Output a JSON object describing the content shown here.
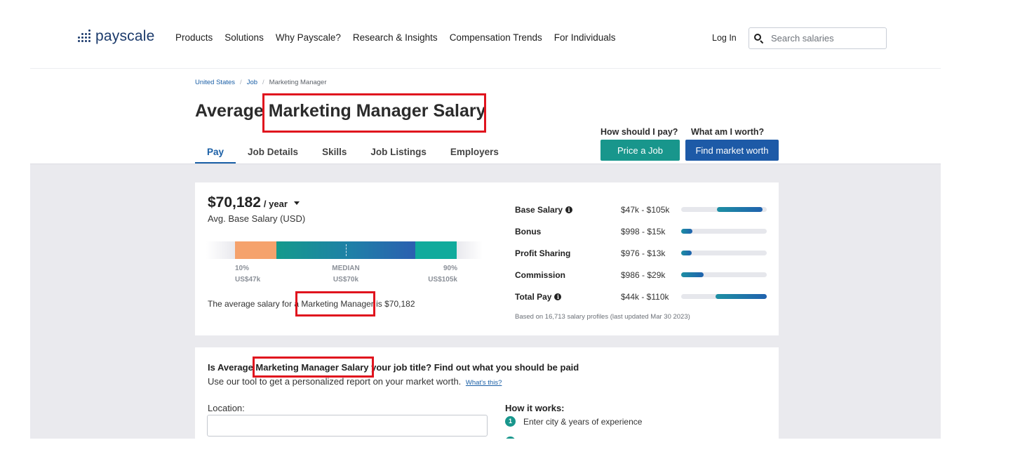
{
  "brand": {
    "logo_text": "payscale"
  },
  "nav": {
    "links": [
      "Products",
      "Solutions",
      "Why Payscale?",
      "Research & Insights",
      "Compensation Trends",
      "For Individuals"
    ],
    "login": "Log In",
    "search_placeholder": "Search salaries"
  },
  "breadcrumb": [
    "United States",
    "Job",
    "Marketing Manager"
  ],
  "page_title": "Average Marketing Manager Salary",
  "tabs": [
    "Pay",
    "Job Details",
    "Skills",
    "Job Listings",
    "Employers"
  ],
  "active_tab": "Pay",
  "cta": {
    "q1": "How should I pay?",
    "q2": "What am I worth?",
    "btn1": "Price a Job",
    "btn2": "Find market worth"
  },
  "salary_card": {
    "amount": "$70,182",
    "period": "/ year",
    "label": "Avg. Base Salary (USD)",
    "percentiles": [
      {
        "label": "10%",
        "value": "US$47k"
      },
      {
        "label": "MEDIAN",
        "value": "US$70k"
      },
      {
        "label": "90%",
        "value": "US$105k"
      }
    ],
    "sentence": "The average salary for a Marketing Manager is $70,182",
    "ranges": [
      {
        "label": "Base Salary",
        "info": true,
        "value": "$47k - $105k",
        "bar": [
          0.42,
          0.95
        ]
      },
      {
        "label": "Bonus",
        "info": false,
        "value": "$998 - $15k",
        "bar": [
          0.0,
          0.13
        ]
      },
      {
        "label": "Profit Sharing",
        "info": false,
        "value": "$976 - $13k",
        "bar": [
          0.0,
          0.12
        ]
      },
      {
        "label": "Commission",
        "info": false,
        "value": "$986 - $29k",
        "bar": [
          0.0,
          0.26
        ]
      },
      {
        "label": "Total Pay",
        "info": true,
        "value": "$44k - $110k",
        "bar": [
          0.4,
          1.0
        ]
      }
    ],
    "based_on": "Based on 16,713 salary profiles (last updated Mar 30 2023)"
  },
  "personalize": {
    "title": "Is Average Marketing Manager Salary your job title? Find out what you should be paid",
    "subtitle": "Use our tool to get a personalized report on your market worth.",
    "whats_this": "What's this?",
    "location_label": "Location:",
    "how_it_works": "How it works:",
    "steps": [
      "Enter city & years of experience"
    ]
  },
  "colors": {
    "accent_blue": "#1d5aa7",
    "accent_teal": "#18968c",
    "highlight_red": "#e0141e"
  }
}
